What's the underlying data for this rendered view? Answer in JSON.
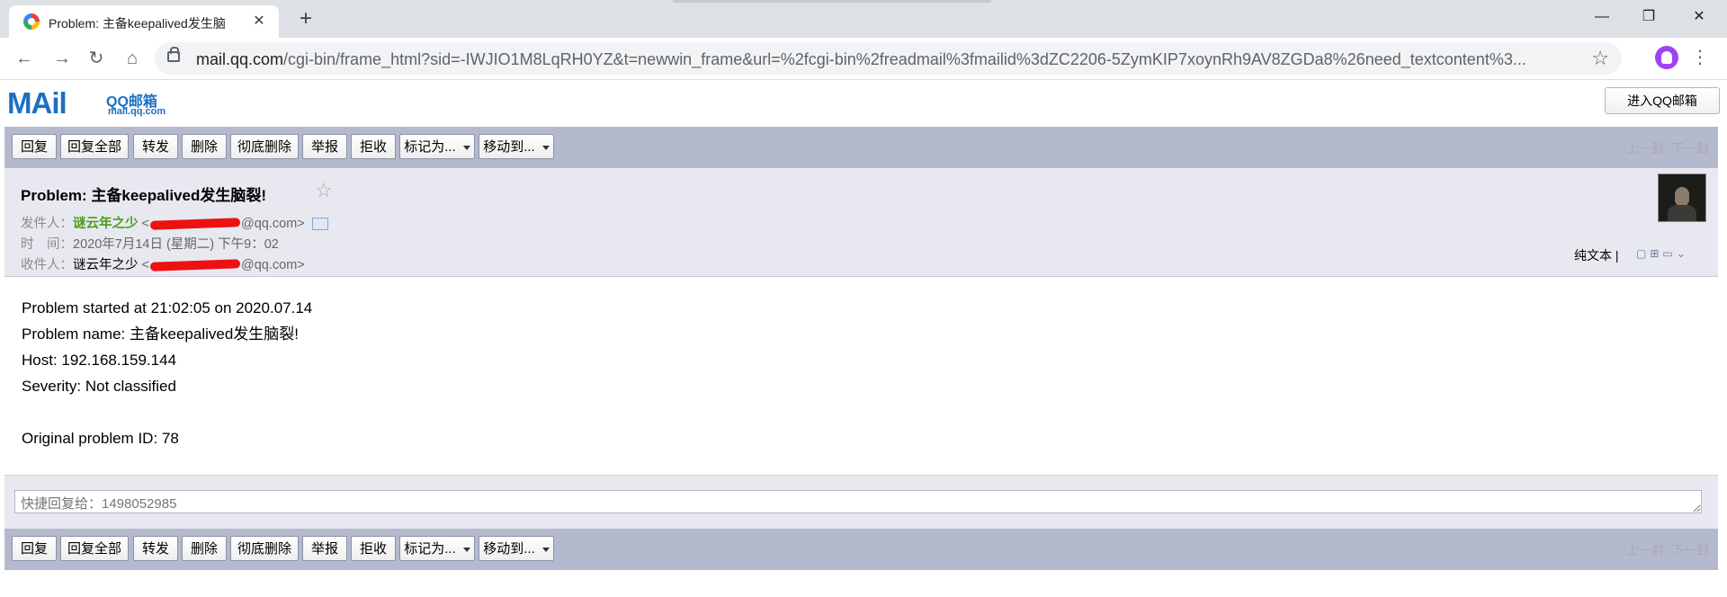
{
  "browser": {
    "tab_title": "Problem: 主备keepalived发生脑",
    "url_host": "mail.qq.com",
    "url_path": "/cgi-bin/frame_html?sid=-IWJIO1M8LqRH0YZ&t=newwin_frame&url=%2fcgi-bin%2freadmail%3fmailid%3dZC2206-5ZymKIP7xoynRh9AV8ZGDa8%26need_textcontent%3..."
  },
  "logo": {
    "mail": "MAil",
    "brand": "QQ邮箱",
    "domain": "mail.qq.com"
  },
  "enter_button": "进入QQ邮箱",
  "actions": {
    "reply": "回复",
    "reply_all": "回复全部",
    "forward": "转发",
    "delete": "删除",
    "delete_permanent": "彻底删除",
    "report": "举报",
    "reject": "拒收",
    "mark_as": "标记为...",
    "move_to": "移动到..."
  },
  "pager": {
    "prev": "上一封",
    "next": "下一封"
  },
  "email": {
    "subject": "Problem: 主备keepalived发生脑裂!",
    "from_label": "发件人：",
    "from_name": "谜云年之少",
    "from_domain": "@qq.com>",
    "time_label": "时　间：",
    "time_value": "2020年7月14日 (星期二) 下午9：02",
    "to_label": "收件人：",
    "to_name": "谜云年之少",
    "to_domain": "@qq.com>",
    "plain_text": "纯文本"
  },
  "body_lines": [
    "Problem started at 21:02:05 on 2020.07.14",
    "Problem name: 主备keepalived发生脑裂!",
    "Host: 192.168.159.144",
    "Severity: Not classified",
    "",
    "Original problem ID: 78"
  ],
  "quick_reply_placeholder": "快捷回复给：1498052985"
}
